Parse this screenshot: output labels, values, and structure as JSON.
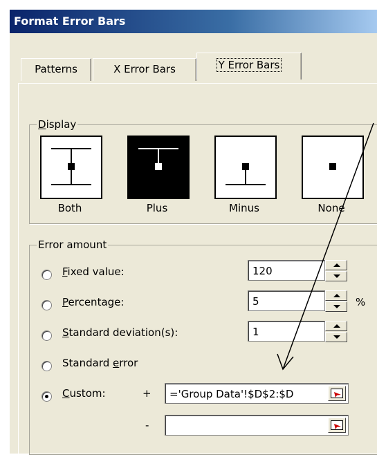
{
  "window": {
    "title": "Format Error Bars"
  },
  "tabs": [
    {
      "label": "Patterns"
    },
    {
      "label": "X Error Bars"
    },
    {
      "label": "Y Error Bars"
    }
  ],
  "display": {
    "legend": "Display",
    "options": [
      {
        "label": "Both",
        "selected": false
      },
      {
        "label": "Plus",
        "selected": true
      },
      {
        "label": "Minus",
        "selected": false
      },
      {
        "label": "None",
        "selected": false
      }
    ]
  },
  "error_amount": {
    "legend": "Error amount",
    "fixed_value": {
      "label": "Fixed value:",
      "value": "120",
      "selected": false
    },
    "percentage": {
      "label": "Percentage:",
      "value": "5",
      "unit": "%",
      "selected": false
    },
    "std_dev": {
      "label": "Standard deviation(s):",
      "value": "1",
      "selected": false
    },
    "std_error": {
      "label": "Standard error",
      "selected": false
    },
    "custom": {
      "label": "Custom:",
      "selected": true,
      "plus_sign": "+",
      "plus_value": "='Group Data'!$D$2:$D",
      "minus_sign": "-",
      "minus_value": ""
    }
  },
  "colors": {
    "title_bar": "#0a246a",
    "dialog_bg": "#ece9d8"
  }
}
